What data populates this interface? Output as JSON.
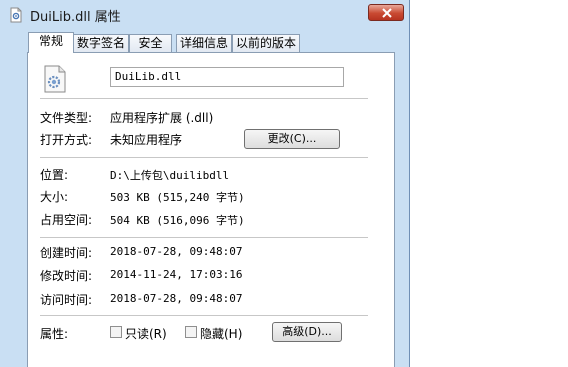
{
  "window": {
    "title": "DuiLib.dll 属性"
  },
  "tabs": [
    {
      "label": "常规"
    },
    {
      "label": "数字签名"
    },
    {
      "label": "安全"
    },
    {
      "label": "详细信息"
    },
    {
      "label": "以前的版本"
    }
  ],
  "general": {
    "filename": "DuiLib.dll",
    "file_type_label": "文件类型:",
    "file_type_value": "应用程序扩展 (.dll)",
    "open_with_label": "打开方式:",
    "open_with_value": "未知应用程序",
    "change_button": "更改(C)...",
    "location_label": "位置:",
    "location_value": "D:\\上传包\\duilibdll",
    "size_label": "大小:",
    "size_value": "503 KB (515,240 字节)",
    "size_on_disk_label": "占用空间:",
    "size_on_disk_value": "504 KB (516,096 字节)",
    "created_label": "创建时间:",
    "created_value": "2018-07-28, 09:48:07",
    "modified_label": "修改时间:",
    "modified_value": "2014-11-24, 17:03:16",
    "accessed_label": "访问时间:",
    "accessed_value": "2018-07-28, 09:48:07",
    "attributes_label": "属性:",
    "readonly_label": "只读(R)",
    "hidden_label": "隐藏(H)",
    "advanced_button": "高级(D)..."
  },
  "icons": {
    "app_icon": "dll-file-icon",
    "file_icon": "dll-file-gear-icon",
    "close_icon": "close-x-icon"
  },
  "colors": {
    "window_frame": "#c9dff3",
    "close_button": "#c94a32",
    "panel_background": "#ffffff"
  }
}
